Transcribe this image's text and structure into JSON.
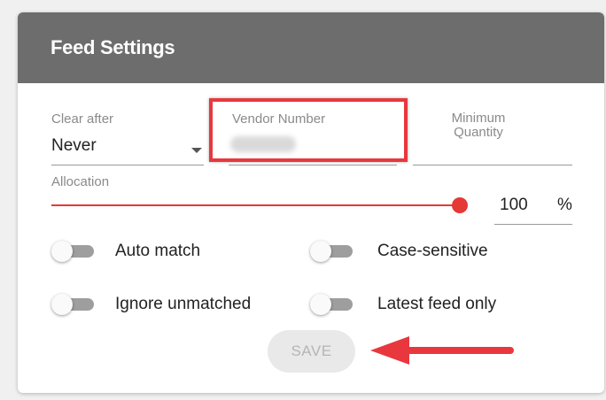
{
  "card": {
    "title": "Feed Settings"
  },
  "fields": {
    "clear_after": {
      "label": "Clear after",
      "value": "Never"
    },
    "vendor_number": {
      "label": "Vendor Number"
    },
    "minimum_quantity": {
      "label_line1": "Minimum",
      "label_line2": "Quantity"
    },
    "allocation": {
      "label": "Allocation",
      "value": "100",
      "unit": "%",
      "slider_percent": 100
    }
  },
  "toggles": {
    "auto_match": {
      "label": "Auto match",
      "on": false
    },
    "case_sensitive": {
      "label": "Case-sensitive",
      "on": false
    },
    "ignore_unmatched": {
      "label": "Ignore unmatched",
      "on": false
    },
    "latest_feed_only": {
      "label": "Latest feed only",
      "on": false
    }
  },
  "save_button": {
    "label": "SAVE",
    "enabled": false
  },
  "colors": {
    "header_bg": "#6d6d6d",
    "accent_red": "#e53935",
    "annotation_red": "#e8383d",
    "toggle_off_track": "#9e9e9e",
    "save_disabled_bg": "#e9e9e9"
  }
}
